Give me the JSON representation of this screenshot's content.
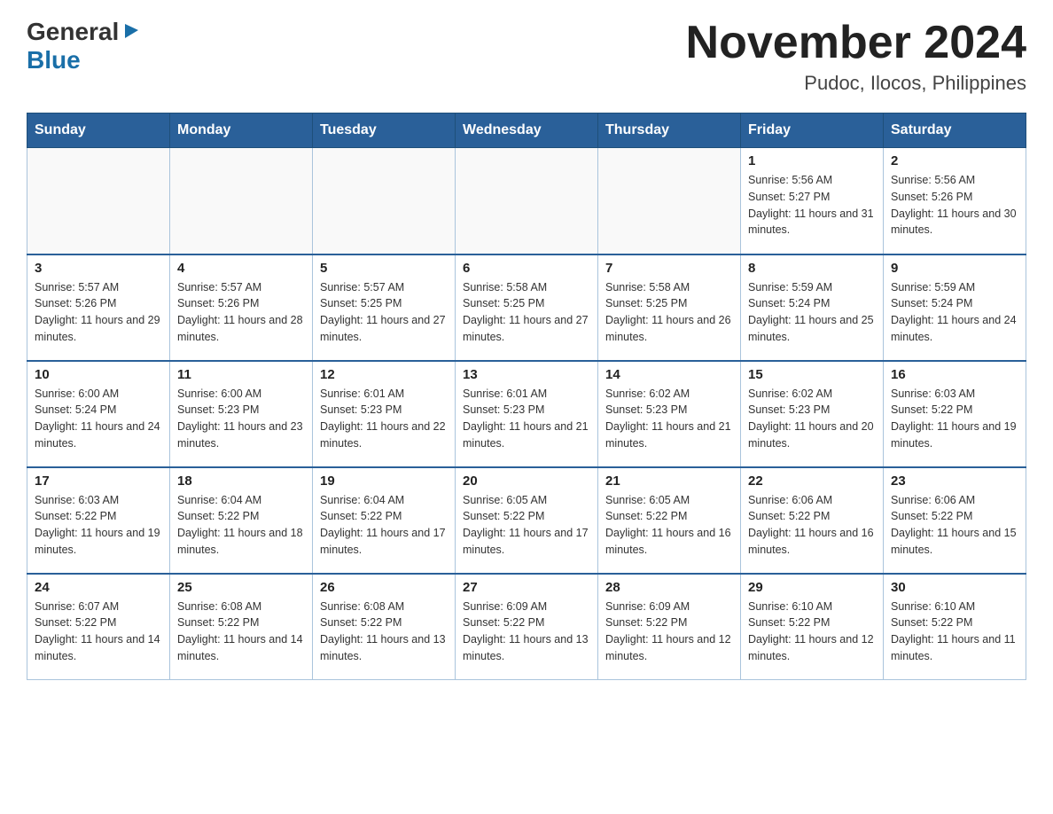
{
  "header": {
    "logo_general": "General",
    "logo_blue": "Blue",
    "month_title": "November 2024",
    "location": "Pudoc, Ilocos, Philippines"
  },
  "weekdays": [
    "Sunday",
    "Monday",
    "Tuesday",
    "Wednesday",
    "Thursday",
    "Friday",
    "Saturday"
  ],
  "weeks": [
    [
      {
        "day": "",
        "sunrise": "",
        "sunset": "",
        "daylight": ""
      },
      {
        "day": "",
        "sunrise": "",
        "sunset": "",
        "daylight": ""
      },
      {
        "day": "",
        "sunrise": "",
        "sunset": "",
        "daylight": ""
      },
      {
        "day": "",
        "sunrise": "",
        "sunset": "",
        "daylight": ""
      },
      {
        "day": "",
        "sunrise": "",
        "sunset": "",
        "daylight": ""
      },
      {
        "day": "1",
        "sunrise": "Sunrise: 5:56 AM",
        "sunset": "Sunset: 5:27 PM",
        "daylight": "Daylight: 11 hours and 31 minutes."
      },
      {
        "day": "2",
        "sunrise": "Sunrise: 5:56 AM",
        "sunset": "Sunset: 5:26 PM",
        "daylight": "Daylight: 11 hours and 30 minutes."
      }
    ],
    [
      {
        "day": "3",
        "sunrise": "Sunrise: 5:57 AM",
        "sunset": "Sunset: 5:26 PM",
        "daylight": "Daylight: 11 hours and 29 minutes."
      },
      {
        "day": "4",
        "sunrise": "Sunrise: 5:57 AM",
        "sunset": "Sunset: 5:26 PM",
        "daylight": "Daylight: 11 hours and 28 minutes."
      },
      {
        "day": "5",
        "sunrise": "Sunrise: 5:57 AM",
        "sunset": "Sunset: 5:25 PM",
        "daylight": "Daylight: 11 hours and 27 minutes."
      },
      {
        "day": "6",
        "sunrise": "Sunrise: 5:58 AM",
        "sunset": "Sunset: 5:25 PM",
        "daylight": "Daylight: 11 hours and 27 minutes."
      },
      {
        "day": "7",
        "sunrise": "Sunrise: 5:58 AM",
        "sunset": "Sunset: 5:25 PM",
        "daylight": "Daylight: 11 hours and 26 minutes."
      },
      {
        "day": "8",
        "sunrise": "Sunrise: 5:59 AM",
        "sunset": "Sunset: 5:24 PM",
        "daylight": "Daylight: 11 hours and 25 minutes."
      },
      {
        "day": "9",
        "sunrise": "Sunrise: 5:59 AM",
        "sunset": "Sunset: 5:24 PM",
        "daylight": "Daylight: 11 hours and 24 minutes."
      }
    ],
    [
      {
        "day": "10",
        "sunrise": "Sunrise: 6:00 AM",
        "sunset": "Sunset: 5:24 PM",
        "daylight": "Daylight: 11 hours and 24 minutes."
      },
      {
        "day": "11",
        "sunrise": "Sunrise: 6:00 AM",
        "sunset": "Sunset: 5:23 PM",
        "daylight": "Daylight: 11 hours and 23 minutes."
      },
      {
        "day": "12",
        "sunrise": "Sunrise: 6:01 AM",
        "sunset": "Sunset: 5:23 PM",
        "daylight": "Daylight: 11 hours and 22 minutes."
      },
      {
        "day": "13",
        "sunrise": "Sunrise: 6:01 AM",
        "sunset": "Sunset: 5:23 PM",
        "daylight": "Daylight: 11 hours and 21 minutes."
      },
      {
        "day": "14",
        "sunrise": "Sunrise: 6:02 AM",
        "sunset": "Sunset: 5:23 PM",
        "daylight": "Daylight: 11 hours and 21 minutes."
      },
      {
        "day": "15",
        "sunrise": "Sunrise: 6:02 AM",
        "sunset": "Sunset: 5:23 PM",
        "daylight": "Daylight: 11 hours and 20 minutes."
      },
      {
        "day": "16",
        "sunrise": "Sunrise: 6:03 AM",
        "sunset": "Sunset: 5:22 PM",
        "daylight": "Daylight: 11 hours and 19 minutes."
      }
    ],
    [
      {
        "day": "17",
        "sunrise": "Sunrise: 6:03 AM",
        "sunset": "Sunset: 5:22 PM",
        "daylight": "Daylight: 11 hours and 19 minutes."
      },
      {
        "day": "18",
        "sunrise": "Sunrise: 6:04 AM",
        "sunset": "Sunset: 5:22 PM",
        "daylight": "Daylight: 11 hours and 18 minutes."
      },
      {
        "day": "19",
        "sunrise": "Sunrise: 6:04 AM",
        "sunset": "Sunset: 5:22 PM",
        "daylight": "Daylight: 11 hours and 17 minutes."
      },
      {
        "day": "20",
        "sunrise": "Sunrise: 6:05 AM",
        "sunset": "Sunset: 5:22 PM",
        "daylight": "Daylight: 11 hours and 17 minutes."
      },
      {
        "day": "21",
        "sunrise": "Sunrise: 6:05 AM",
        "sunset": "Sunset: 5:22 PM",
        "daylight": "Daylight: 11 hours and 16 minutes."
      },
      {
        "day": "22",
        "sunrise": "Sunrise: 6:06 AM",
        "sunset": "Sunset: 5:22 PM",
        "daylight": "Daylight: 11 hours and 16 minutes."
      },
      {
        "day": "23",
        "sunrise": "Sunrise: 6:06 AM",
        "sunset": "Sunset: 5:22 PM",
        "daylight": "Daylight: 11 hours and 15 minutes."
      }
    ],
    [
      {
        "day": "24",
        "sunrise": "Sunrise: 6:07 AM",
        "sunset": "Sunset: 5:22 PM",
        "daylight": "Daylight: 11 hours and 14 minutes."
      },
      {
        "day": "25",
        "sunrise": "Sunrise: 6:08 AM",
        "sunset": "Sunset: 5:22 PM",
        "daylight": "Daylight: 11 hours and 14 minutes."
      },
      {
        "day": "26",
        "sunrise": "Sunrise: 6:08 AM",
        "sunset": "Sunset: 5:22 PM",
        "daylight": "Daylight: 11 hours and 13 minutes."
      },
      {
        "day": "27",
        "sunrise": "Sunrise: 6:09 AM",
        "sunset": "Sunset: 5:22 PM",
        "daylight": "Daylight: 11 hours and 13 minutes."
      },
      {
        "day": "28",
        "sunrise": "Sunrise: 6:09 AM",
        "sunset": "Sunset: 5:22 PM",
        "daylight": "Daylight: 11 hours and 12 minutes."
      },
      {
        "day": "29",
        "sunrise": "Sunrise: 6:10 AM",
        "sunset": "Sunset: 5:22 PM",
        "daylight": "Daylight: 11 hours and 12 minutes."
      },
      {
        "day": "30",
        "sunrise": "Sunrise: 6:10 AM",
        "sunset": "Sunset: 5:22 PM",
        "daylight": "Daylight: 11 hours and 11 minutes."
      }
    ]
  ]
}
